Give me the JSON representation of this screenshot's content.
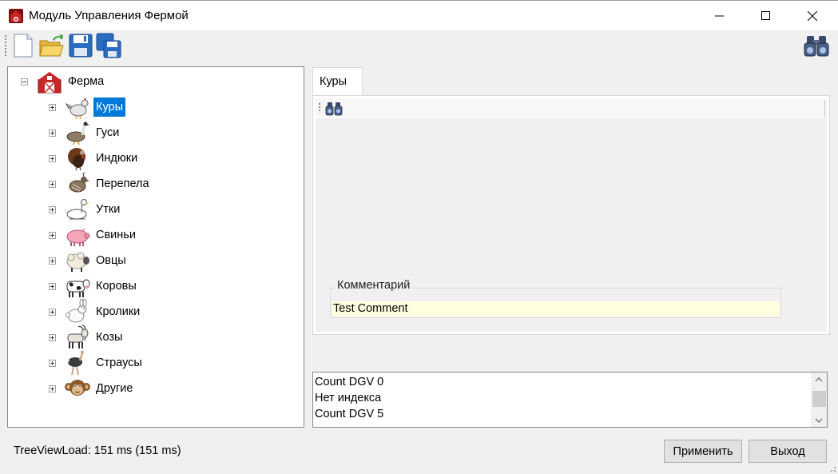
{
  "window": {
    "title": "Модуль Управления Фермой",
    "accent": "#0078d7"
  },
  "toolbar": {
    "buttons": [
      {
        "name": "new",
        "icon": "new-document-icon"
      },
      {
        "name": "open",
        "icon": "open-folder-icon"
      },
      {
        "name": "save",
        "icon": "save-icon"
      },
      {
        "name": "save_all",
        "icon": "save-all-icon"
      }
    ],
    "right_icon": "binoculars-icon"
  },
  "tree": {
    "root": {
      "label": "Ферма",
      "icon": "barn-icon",
      "expanded": true
    },
    "items": [
      {
        "label": "Куры",
        "icon": "chicken-icon",
        "selected": true
      },
      {
        "label": "Гуси",
        "icon": "goose-icon"
      },
      {
        "label": "Индюки",
        "icon": "turkey-icon"
      },
      {
        "label": "Перепела",
        "icon": "quail-icon"
      },
      {
        "label": "Утки",
        "icon": "duck-icon"
      },
      {
        "label": "Свиньи",
        "icon": "pig-icon"
      },
      {
        "label": "Овцы",
        "icon": "sheep-icon"
      },
      {
        "label": "Коровы",
        "icon": "cow-icon"
      },
      {
        "label": "Кролики",
        "icon": "rabbit-icon"
      },
      {
        "label": "Козы",
        "icon": "goat-icon"
      },
      {
        "label": "Страусы",
        "icon": "ostrich-icon"
      },
      {
        "label": "Другие",
        "icon": "monkey-icon"
      }
    ]
  },
  "tabs": [
    {
      "label": "Куры",
      "active": true
    }
  ],
  "comment": {
    "group_title": "Комментарий",
    "value": "Test Comment"
  },
  "log": {
    "lines": [
      "Count DGV 0",
      "Нет индекса",
      "Count DGV 5"
    ]
  },
  "status": {
    "text": "TreeViewLoad: 151 ms (151 ms)"
  },
  "buttons": {
    "apply": "Применить",
    "exit": "Выход"
  }
}
